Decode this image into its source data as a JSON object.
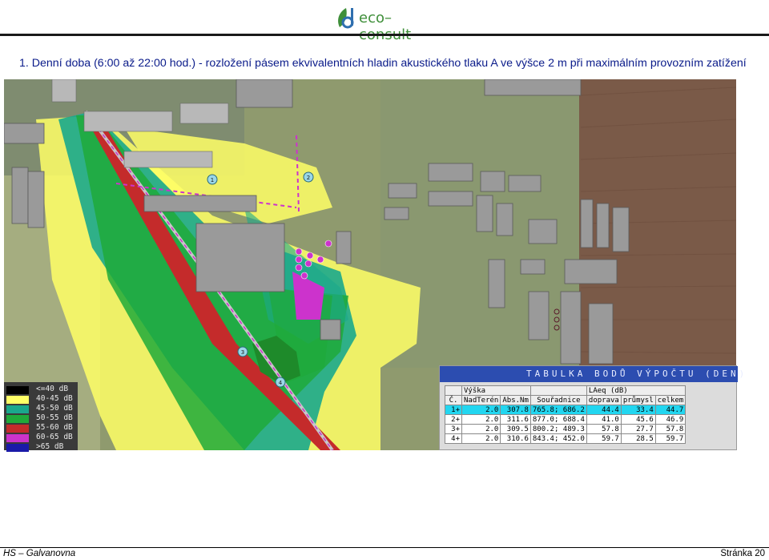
{
  "header": {
    "logo_text": "eco–consult",
    "title": "1.  Denní doba (6:00 až 22:00 hod.) - rozložení pásem ekvivalentních hladin akustického tlaku A ve výšce 2 m při maximálním provozním zatížení"
  },
  "map": {
    "point_labels": [
      "1",
      "2",
      "3",
      "4"
    ],
    "legend": [
      {
        "label": "<=40 dB",
        "color": "#000000"
      },
      {
        "label": "40-45 dB",
        "color": "#ffff66"
      },
      {
        "label": "45-50 dB",
        "color": "#1aa88c"
      },
      {
        "label": "50-55 dB",
        "color": "#1faa3a"
      },
      {
        "label": "55-60 dB",
        "color": "#c42b2b"
      },
      {
        "label": "60-65 dB",
        "color": "#cc33cc"
      },
      {
        "label": ">65 dB",
        "color": "#1a1aa8"
      }
    ]
  },
  "table": {
    "title": "TABULKA BODŮ VÝPOČTU (DEN)",
    "group_vyska": "Výška",
    "group_laeq": "LAeq (dB)",
    "headers": [
      "Č.",
      "NadTerén",
      "Abs.Nm",
      "Souřadnice",
      "doprava",
      "průmysl",
      "celkem"
    ],
    "rows": [
      [
        "1+",
        "2.0",
        "307.8",
        "765.8; 686.2",
        "44.4",
        "33.4",
        "44.7"
      ],
      [
        "2+",
        "2.0",
        "311.6",
        "877.0; 688.4",
        "41.0",
        "45.6",
        "46.9"
      ],
      [
        "3+",
        "2.0",
        "309.5",
        "800.2; 489.3",
        "57.8",
        "27.7",
        "57.8"
      ],
      [
        "4+",
        "2.0",
        "310.6",
        "843.4; 452.0",
        "59.7",
        "28.5",
        "59.7"
      ]
    ]
  },
  "footer": {
    "left": "HS – Galvanovna",
    "right": "Stránka 20"
  }
}
